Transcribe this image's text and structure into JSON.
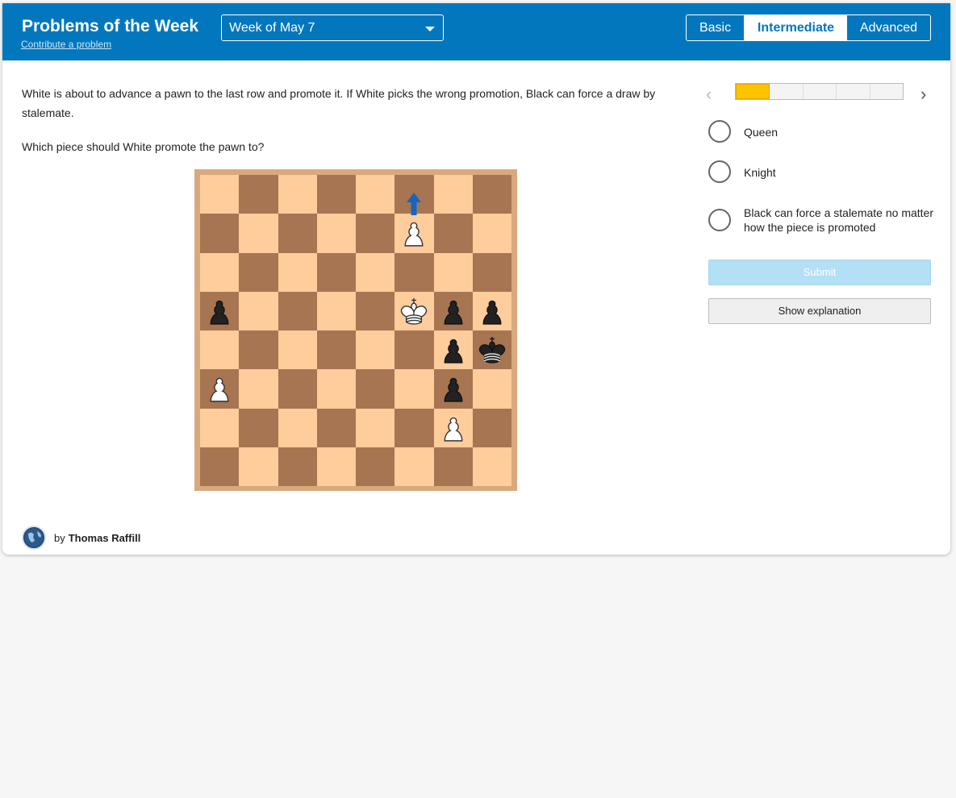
{
  "header": {
    "title": "Problems of the Week",
    "contribute_link": "Contribute a problem",
    "week_select": "Week of May 7",
    "levels": [
      "Basic",
      "Intermediate",
      "Advanced"
    ],
    "active_level": "Intermediate"
  },
  "problem": {
    "text": "White is about to advance a pawn to the last row and promote it. If White picks the wrong promotion, Black can force a draw by stalemate.",
    "question": "Which piece should White promote the pawn to?",
    "board": {
      "pieces": [
        {
          "square": "f7",
          "piece": "white-pawn"
        },
        {
          "square": "a5",
          "piece": "black-pawn"
        },
        {
          "square": "f5",
          "piece": "white-king"
        },
        {
          "square": "g5",
          "piece": "black-pawn"
        },
        {
          "square": "h5",
          "piece": "black-pawn"
        },
        {
          "square": "g4",
          "piece": "black-pawn"
        },
        {
          "square": "h4",
          "piece": "black-king"
        },
        {
          "square": "a3",
          "piece": "white-pawn"
        },
        {
          "square": "g3",
          "piece": "black-pawn"
        },
        {
          "square": "g2",
          "piece": "white-pawn"
        }
      ],
      "arrow": {
        "from": "f7",
        "to": "f8",
        "color": "#1565c0"
      }
    },
    "author_prefix": "by",
    "author": "Thomas Raffill"
  },
  "sidebar": {
    "progress": {
      "current": 1,
      "total": 5
    },
    "options": [
      "Queen",
      "Knight",
      "Black can force a stalemate no matter how the piece is promoted"
    ],
    "submit_label": "Submit",
    "explanation_label": "Show explanation"
  },
  "colors": {
    "header_bg": "#0277bd",
    "light_square": "#ffcc9c",
    "dark_square": "#a77551",
    "progress_fill": "#ffc400"
  }
}
